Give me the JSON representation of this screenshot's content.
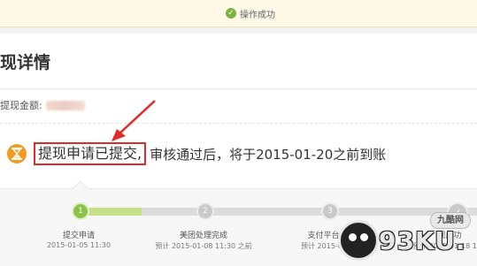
{
  "toast": {
    "icon": "check-icon",
    "text": "操作成功"
  },
  "page": {
    "title": "现详情"
  },
  "amount": {
    "label": "提现金额:"
  },
  "status": {
    "icon": "hourglass-icon",
    "highlight": "提现申请已提交,",
    "rest": "审核通过后，将于2015-01-20之前到账"
  },
  "steps": [
    {
      "number": "1",
      "label": "提交申请",
      "date": "2015-01-05 11:30",
      "state": "done"
    },
    {
      "number": "2",
      "label": "美团处理完成",
      "date": "预计 2015-01-08 11:30 之前",
      "state": "todo"
    },
    {
      "number": "3",
      "label": "支付平台处",
      "date": "预计 2015-01",
      "state": "todo"
    },
    {
      "number": "✓",
      "label": "现成功",
      "date": "预计 2015-01-18 11:3",
      "state": "todo"
    }
  ],
  "watermark": {
    "badge": "九酷网",
    "text": "93KU",
    "suffix": "."
  },
  "colors": {
    "accent_green": "#8bc34a",
    "highlight_red": "#e02b2b",
    "hourglass_orange": "#f29c1f"
  }
}
